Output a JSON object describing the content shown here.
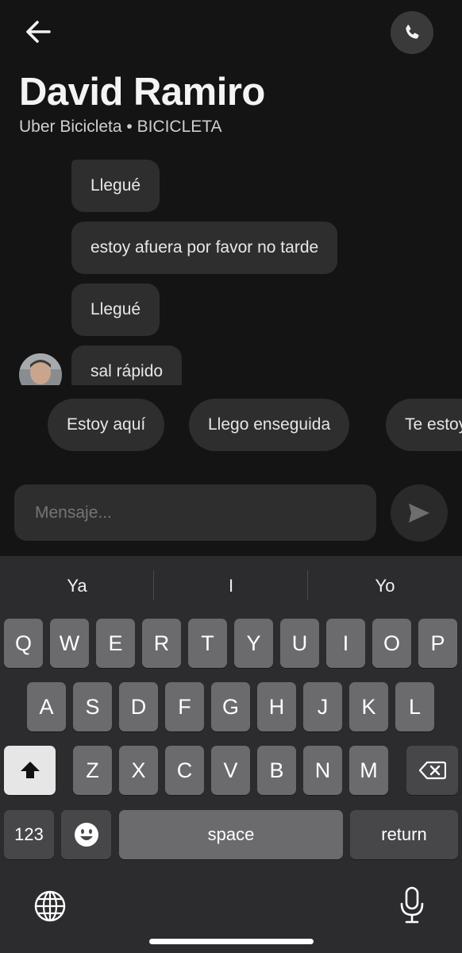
{
  "header": {
    "title": "David Ramiro",
    "subtitle": "Uber Bicicleta • BICICLETA",
    "back_icon": "arrow-left-icon",
    "call_icon": "phone-icon"
  },
  "messages": [
    {
      "text": "Llegué"
    },
    {
      "text": "estoy afuera por favor no tarde"
    },
    {
      "text": "Llegué"
    },
    {
      "text": "sal rápido"
    }
  ],
  "quick_replies": [
    "Estoy aquí",
    "Llego enseguida",
    "Te estoy"
  ],
  "composer": {
    "placeholder": "Mensaje...",
    "send_icon": "send-arrow-icon"
  },
  "keyboard": {
    "suggestions": [
      "Ya",
      "I",
      "Yo"
    ],
    "row1": [
      "Q",
      "W",
      "E",
      "R",
      "T",
      "Y",
      "U",
      "I",
      "O",
      "P"
    ],
    "row2": [
      "A",
      "S",
      "D",
      "F",
      "G",
      "H",
      "J",
      "K",
      "L"
    ],
    "row3": [
      "Z",
      "X",
      "C",
      "V",
      "B",
      "N",
      "M"
    ],
    "numbers_label": "123",
    "space_label": "space",
    "return_label": "return",
    "icons": [
      "shift-icon",
      "backspace-icon",
      "emoji-icon",
      "globe-icon",
      "microphone-icon"
    ]
  },
  "colors": {
    "background": "#141414",
    "bubble": "#2e2e2e",
    "keyboard_bg": "#2c2c2e",
    "key": "#6b6b6d",
    "key_dark": "#474749",
    "shift_active": "#e6e6e6"
  }
}
